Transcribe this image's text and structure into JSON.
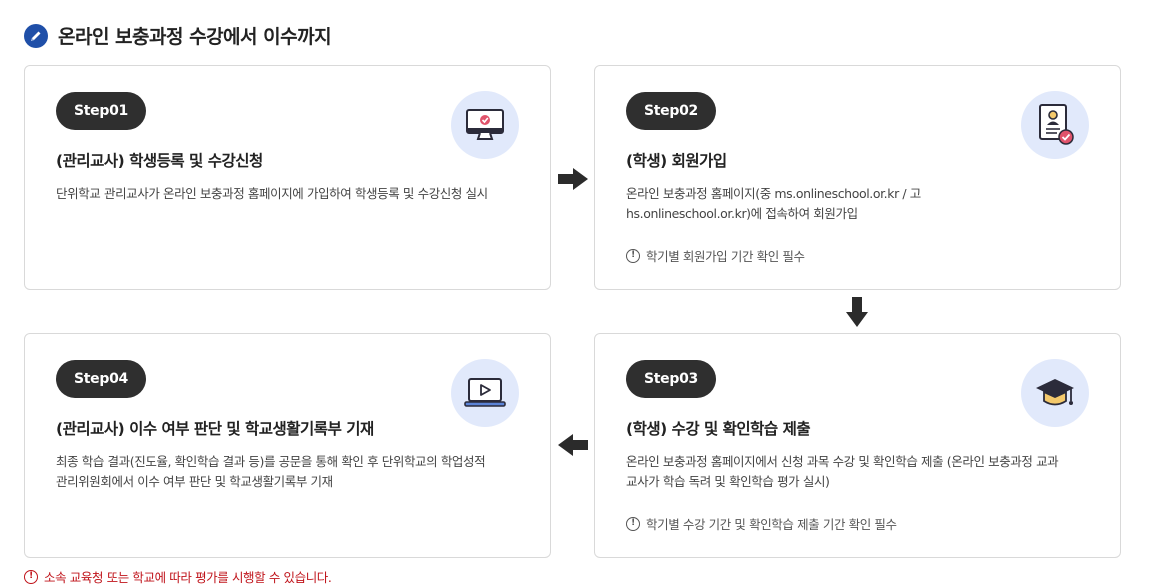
{
  "title": "온라인 보충과정 수강에서 이수까지",
  "steps": [
    {
      "badge": "Step01",
      "title": "(관리교사) 학생등록 및 수강신청",
      "desc": "단위학교 관리교사가 온라인 보충과정 홈페이지에 가입하여 학생등록 및 수강신청 실시",
      "icon": "monitor-check-icon"
    },
    {
      "badge": "Step02",
      "title": "(학생) 회원가입",
      "desc": "온라인 보충과정 홈페이지(중 ms.onlineschool.or.kr / 고 hs.onlineschool.or.kr)에 접속하여 회원가입",
      "note": "학기별 회원가입 기간 확인 필수",
      "icon": "id-card-check-icon"
    },
    {
      "badge": "Step04",
      "title": "(관리교사) 이수 여부 판단 및 학교생활기록부 기재",
      "desc": "최종 학습 결과(진도율, 확인학습 결과 등)를 공문을 통해 확인 후 단위학교의 학업성적관리위원회에서 이수 여부 판단 및 학교생활기록부 기재",
      "icon": "laptop-play-icon"
    },
    {
      "badge": "Step03",
      "title": "(학생) 수강 및 확인학습 제출",
      "desc": "온라인 보충과정 홈페이지에서 신청 과목 수강 및 확인학습 제출 (온라인 보충과정 교과교사가 학습 독려 및 확인학습 평가 실시)",
      "note": "학기별 수강 기간 및 확인학습 제출 기간 확인 필수",
      "icon": "graduation-cap-icon"
    }
  ],
  "info_glyph": "!",
  "footnote": "소속 교육청 또는 학교에 따라 평가를 시행할 수 있습니다.",
  "colors": {
    "badge": "#2f2f2f",
    "icon_circle": "#e1e9fb",
    "accent": "#1f4fa8",
    "footnote": "#c0141b",
    "check": "#e0536b"
  }
}
